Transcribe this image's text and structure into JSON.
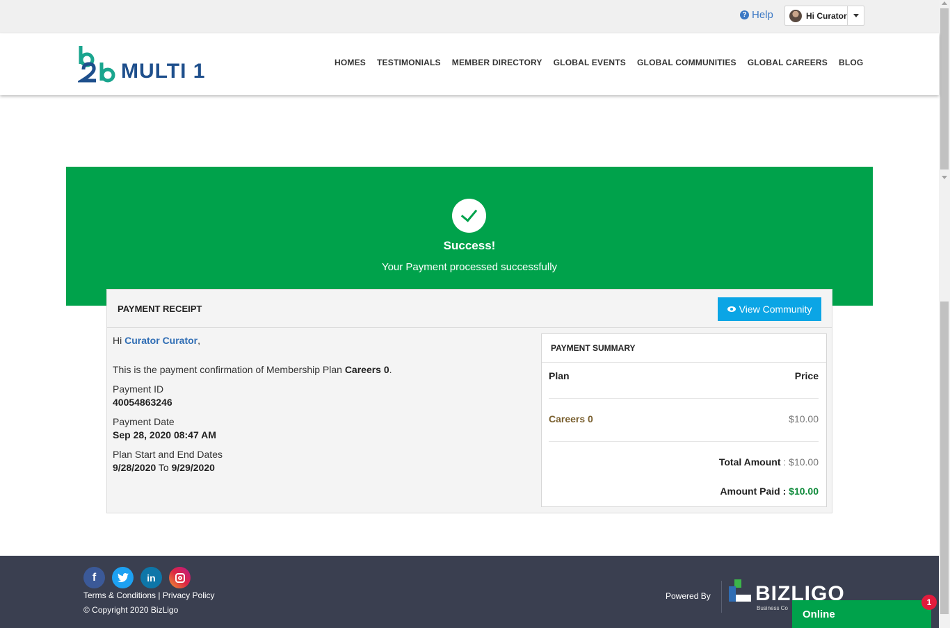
{
  "topbar": {
    "help_label": "Help",
    "user_greeting": "Hi Curator"
  },
  "brand": {
    "logo_text": "MULTI 1",
    "accent": "#1e4f8c"
  },
  "nav": {
    "items": [
      {
        "label": "HOMES"
      },
      {
        "label": "TESTIMONIALS"
      },
      {
        "label": "MEMBER DIRECTORY"
      },
      {
        "label": "GLOBAL EVENTS"
      },
      {
        "label": "GLOBAL COMMUNITIES"
      },
      {
        "label": "GLOBAL CAREERS"
      },
      {
        "label": "BLOG"
      }
    ]
  },
  "banner": {
    "title": "Success!",
    "message": "Your Payment processed successfully",
    "color": "#00a24b"
  },
  "receipt": {
    "title": "PAYMENT RECEIPT",
    "view_button": "View Community",
    "greeting_prefix": "Hi ",
    "user_name": "Curator Curator",
    "greeting_suffix": ",",
    "confirm_prefix": "This is the payment confirmation of Membership Plan ",
    "plan_name": "Careers 0",
    "confirm_suffix": ".",
    "payment_id_label": "Payment ID",
    "payment_id": "40054863246",
    "payment_date_label": "Payment Date",
    "payment_date": "Sep 28, 2020 08:47 AM",
    "dates_label": "Plan Start and End Dates",
    "start_date": "9/28/2020",
    "to_word": " To ",
    "end_date": "9/29/2020"
  },
  "summary": {
    "title": "PAYMENT SUMMARY",
    "col_plan": "Plan",
    "col_price": "Price",
    "plan": "Careers 0",
    "price": "$10.00",
    "total_label": "Total Amount",
    "total_sep": " : ",
    "total_value": "$10.00",
    "paid_label": "Amount Paid : ",
    "paid_value": "$10.00"
  },
  "footer": {
    "terms": "Terms & Conditions",
    "link_sep": " | ",
    "privacy": "Privacy Policy",
    "copyright": "© Copyright 2020 BizLigo",
    "powered_by": "Powered By",
    "bizligo_text": "BIZLIGO",
    "bizligo_sub": "Business Co",
    "socials": [
      {
        "icon": "facebook-icon"
      },
      {
        "icon": "twitter-icon"
      },
      {
        "icon": "linkedin-icon"
      },
      {
        "icon": "instagram-icon"
      }
    ]
  },
  "chat": {
    "label": "Online",
    "badge": "1"
  }
}
